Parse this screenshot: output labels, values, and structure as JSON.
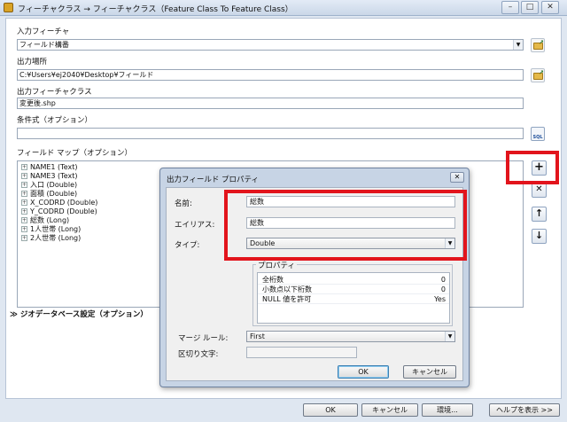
{
  "window": {
    "title": "フィーチャクラス → フィーチャクラス（Feature Class To Feature Class）",
    "minimize": "–",
    "maximize": "□",
    "close": "✕"
  },
  "form": {
    "input_label": "入力フィーチャ",
    "input_value": "フィールド構番",
    "output_location_label": "出力場所",
    "output_location_value": "C:¥Users¥ej2040¥Desktop¥フィールド",
    "output_class_label": "出力フィーチャクラス",
    "output_class_value": "変更後.shp",
    "condition_label": "条件式（オプション）",
    "condition_value": "",
    "fieldmap_label": "フィールド マップ（オプション）",
    "sql_label": "SQL",
    "geodb_label": "ジオデータベース設定（オプション）"
  },
  "fieldmap_items": [
    "NAME1 (Text)",
    "NAME3 (Text)",
    "入口 (Double)",
    "面積 (Double)",
    "X_CODRD (Double)",
    "Y_CODRD (Double)",
    "総数 (Long)",
    "1人世帯 (Long)",
    "2人世帯 (Long)"
  ],
  "side_buttons": {
    "add": "+",
    "remove": "✕",
    "up": "↑",
    "down": "↓"
  },
  "dialog": {
    "title": "出力フィールド プロパティ",
    "close": "✕",
    "name_label": "名前:",
    "name_value": "総数",
    "alias_label": "エイリアス:",
    "alias_value": "総数",
    "type_label": "タイプ:",
    "type_value": "Double",
    "props_group_label": "プロパティ",
    "properties": [
      {
        "name": "全桁数",
        "value": "0"
      },
      {
        "name": "小数点以下桁数",
        "value": "0"
      },
      {
        "name": "NULL 値を許可",
        "value": "Yes"
      }
    ],
    "merge_rule_label": "マージ ルール:",
    "merge_rule_value": "First",
    "delimiter_label": "区切り文字:",
    "delimiter_value": "",
    "ok": "OK",
    "cancel": "キャンセル"
  },
  "footer": {
    "ok": "OK",
    "cancel": "キャンセル",
    "env": "環境...",
    "help": "ヘルプを表示 >>"
  },
  "colors": {
    "highlight": "#e2141c",
    "panel": "#ffffff",
    "chrome": "#dfe7f1"
  }
}
